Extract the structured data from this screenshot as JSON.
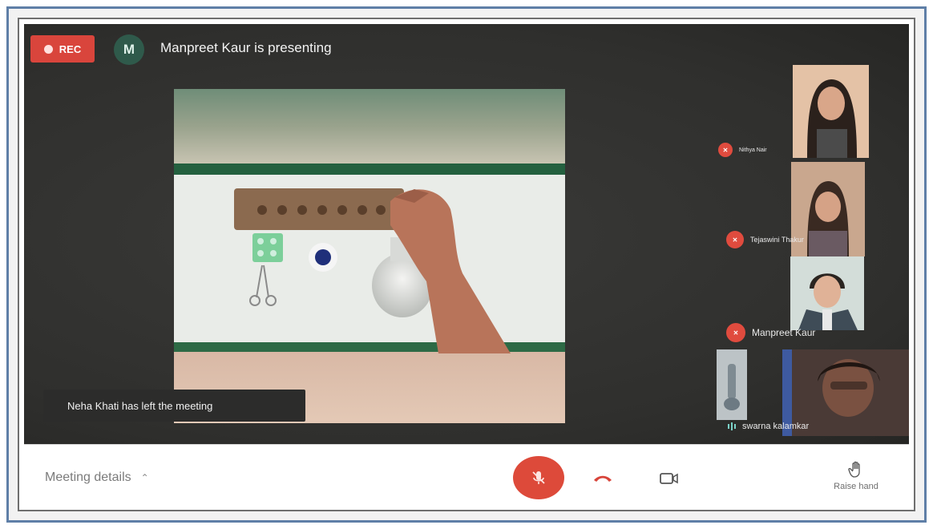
{
  "top": {
    "rec_label": "REC",
    "presenter_initial": "M",
    "presenting_text": "Manpreet Kaur is presenting"
  },
  "toast": {
    "message": "Neha Khati has left the meeting"
  },
  "participants": [
    {
      "name": "Nithya Nair",
      "status": "muted"
    },
    {
      "name": "Tejaswini Thakur",
      "status": "muted"
    },
    {
      "name": "Manpreet Kaur",
      "status": "muted"
    },
    {
      "name": "swarna kalamkar",
      "status": "speaking"
    }
  ],
  "bottom_bar": {
    "meeting_details": "Meeting details",
    "raise_hand": "Raise hand"
  },
  "icons": {
    "rec": "record-dot-icon",
    "mic": "mic-off-icon",
    "hangup": "phone-hangup-icon",
    "camera": "camera-icon",
    "hand": "raise-hand-icon",
    "chevron": "chevron-up-icon"
  },
  "colors": {
    "rec": "#d9453c",
    "mic_button": "#dd4a3a",
    "avatar": "#2f5a4b",
    "background": "#333332"
  }
}
